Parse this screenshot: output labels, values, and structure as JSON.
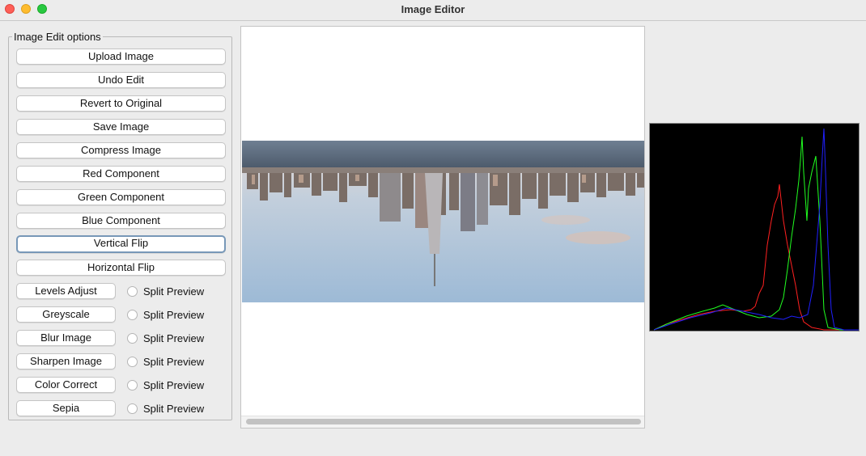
{
  "window": {
    "title": "Image Editor"
  },
  "panel": {
    "legend": "Image Edit options",
    "buttons": [
      "Upload Image",
      "Undo Edit",
      "Revert to Original",
      "Save Image",
      "Compress Image",
      "Red Component",
      "Green Component",
      "Blue Component",
      "Vertical Flip",
      "Horizontal Flip"
    ],
    "focused_button": "Vertical Flip",
    "filters": [
      {
        "label": "Levels Adjust",
        "option": "Split Preview",
        "checked": false
      },
      {
        "label": "Greyscale",
        "option": "Split Preview",
        "checked": false
      },
      {
        "label": "Blur Image",
        "option": "Split Preview",
        "checked": false
      },
      {
        "label": "Sharpen Image",
        "option": "Split Preview",
        "checked": false
      },
      {
        "label": "Color Correct",
        "option": "Split Preview",
        "checked": false
      },
      {
        "label": "Sepia",
        "option": "Split Preview",
        "checked": false
      }
    ]
  },
  "preview": {
    "image_description_icon": "city-skyline-photo-flipped"
  },
  "histogram": {
    "background": "#000000",
    "series_colors": {
      "red": "#ff2020",
      "green": "#20ff20",
      "blue": "#2020ff"
    }
  },
  "colors": {
    "window_bg": "#ececec",
    "focus_ring": "#7898b8"
  }
}
